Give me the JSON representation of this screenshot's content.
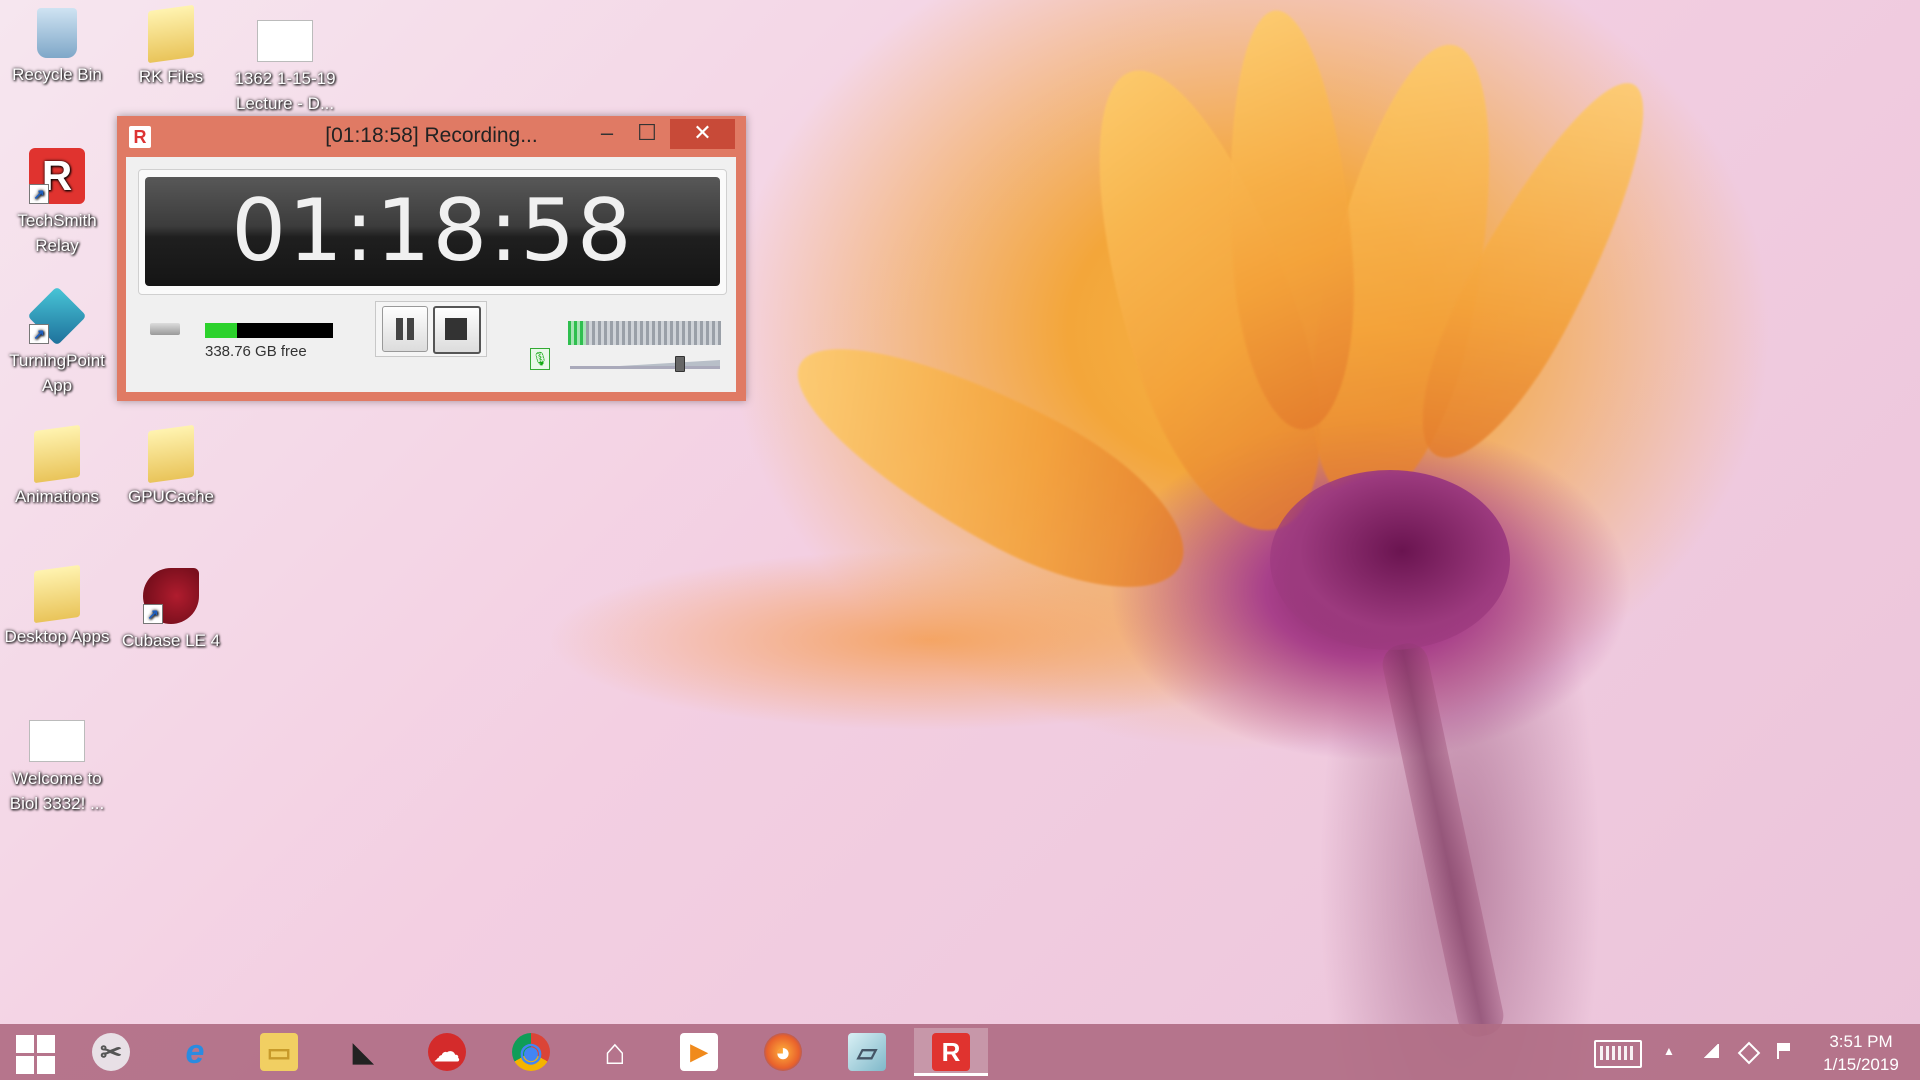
{
  "desktop": {
    "icons": [
      {
        "label": "Recycle Bin"
      },
      {
        "label": "RK Files"
      },
      {
        "label": "1362 1-15-19 Lecture - D..."
      },
      {
        "label": "TechSmith Relay"
      },
      {
        "label": "TurningPoint App"
      },
      {
        "label": "Animations"
      },
      {
        "label": "GPUCache"
      },
      {
        "label": "Desktop Apps"
      },
      {
        "label": "Cubase LE 4"
      },
      {
        "label": "Welcome to Biol 3332! ..."
      }
    ]
  },
  "recorder": {
    "logo": "R",
    "title": "[01:18:58] Recording...",
    "minimize": "–",
    "maximize": "☐",
    "close": "✕",
    "timer": "01:18:58",
    "disk_free": "338.76 GB free",
    "disk_used_fraction": 0.25,
    "audio_level_fraction": 0.12,
    "volume_fraction": 0.75,
    "mic_symbol": "🎙"
  },
  "taskbar": {
    "items": [
      {
        "name": "start",
        "glyph": ""
      },
      {
        "name": "snipping-tool",
        "glyph": "✂"
      },
      {
        "name": "internet-explorer",
        "glyph": "e"
      },
      {
        "name": "file-explorer",
        "glyph": "▭"
      },
      {
        "name": "pen-app",
        "glyph": "◣"
      },
      {
        "name": "cloud-app",
        "glyph": "☁"
      },
      {
        "name": "chrome",
        "glyph": "◉"
      },
      {
        "name": "home-app",
        "glyph": "⌂"
      },
      {
        "name": "media-player",
        "glyph": "▶"
      },
      {
        "name": "firefox",
        "glyph": "◕"
      },
      {
        "name": "notes-app",
        "glyph": "▱"
      },
      {
        "name": "techsmith-relay",
        "glyph": "R"
      }
    ],
    "tray": {
      "up_arrow": "▲",
      "time": "3:51 PM",
      "date": "1/15/2019"
    }
  },
  "colors": {
    "window_frame": "#e07a64",
    "close_button": "#c84a38",
    "taskbar": "#b06c84",
    "disk_fill": "#2cd22c",
    "level_fill": "#2fbf4f"
  }
}
